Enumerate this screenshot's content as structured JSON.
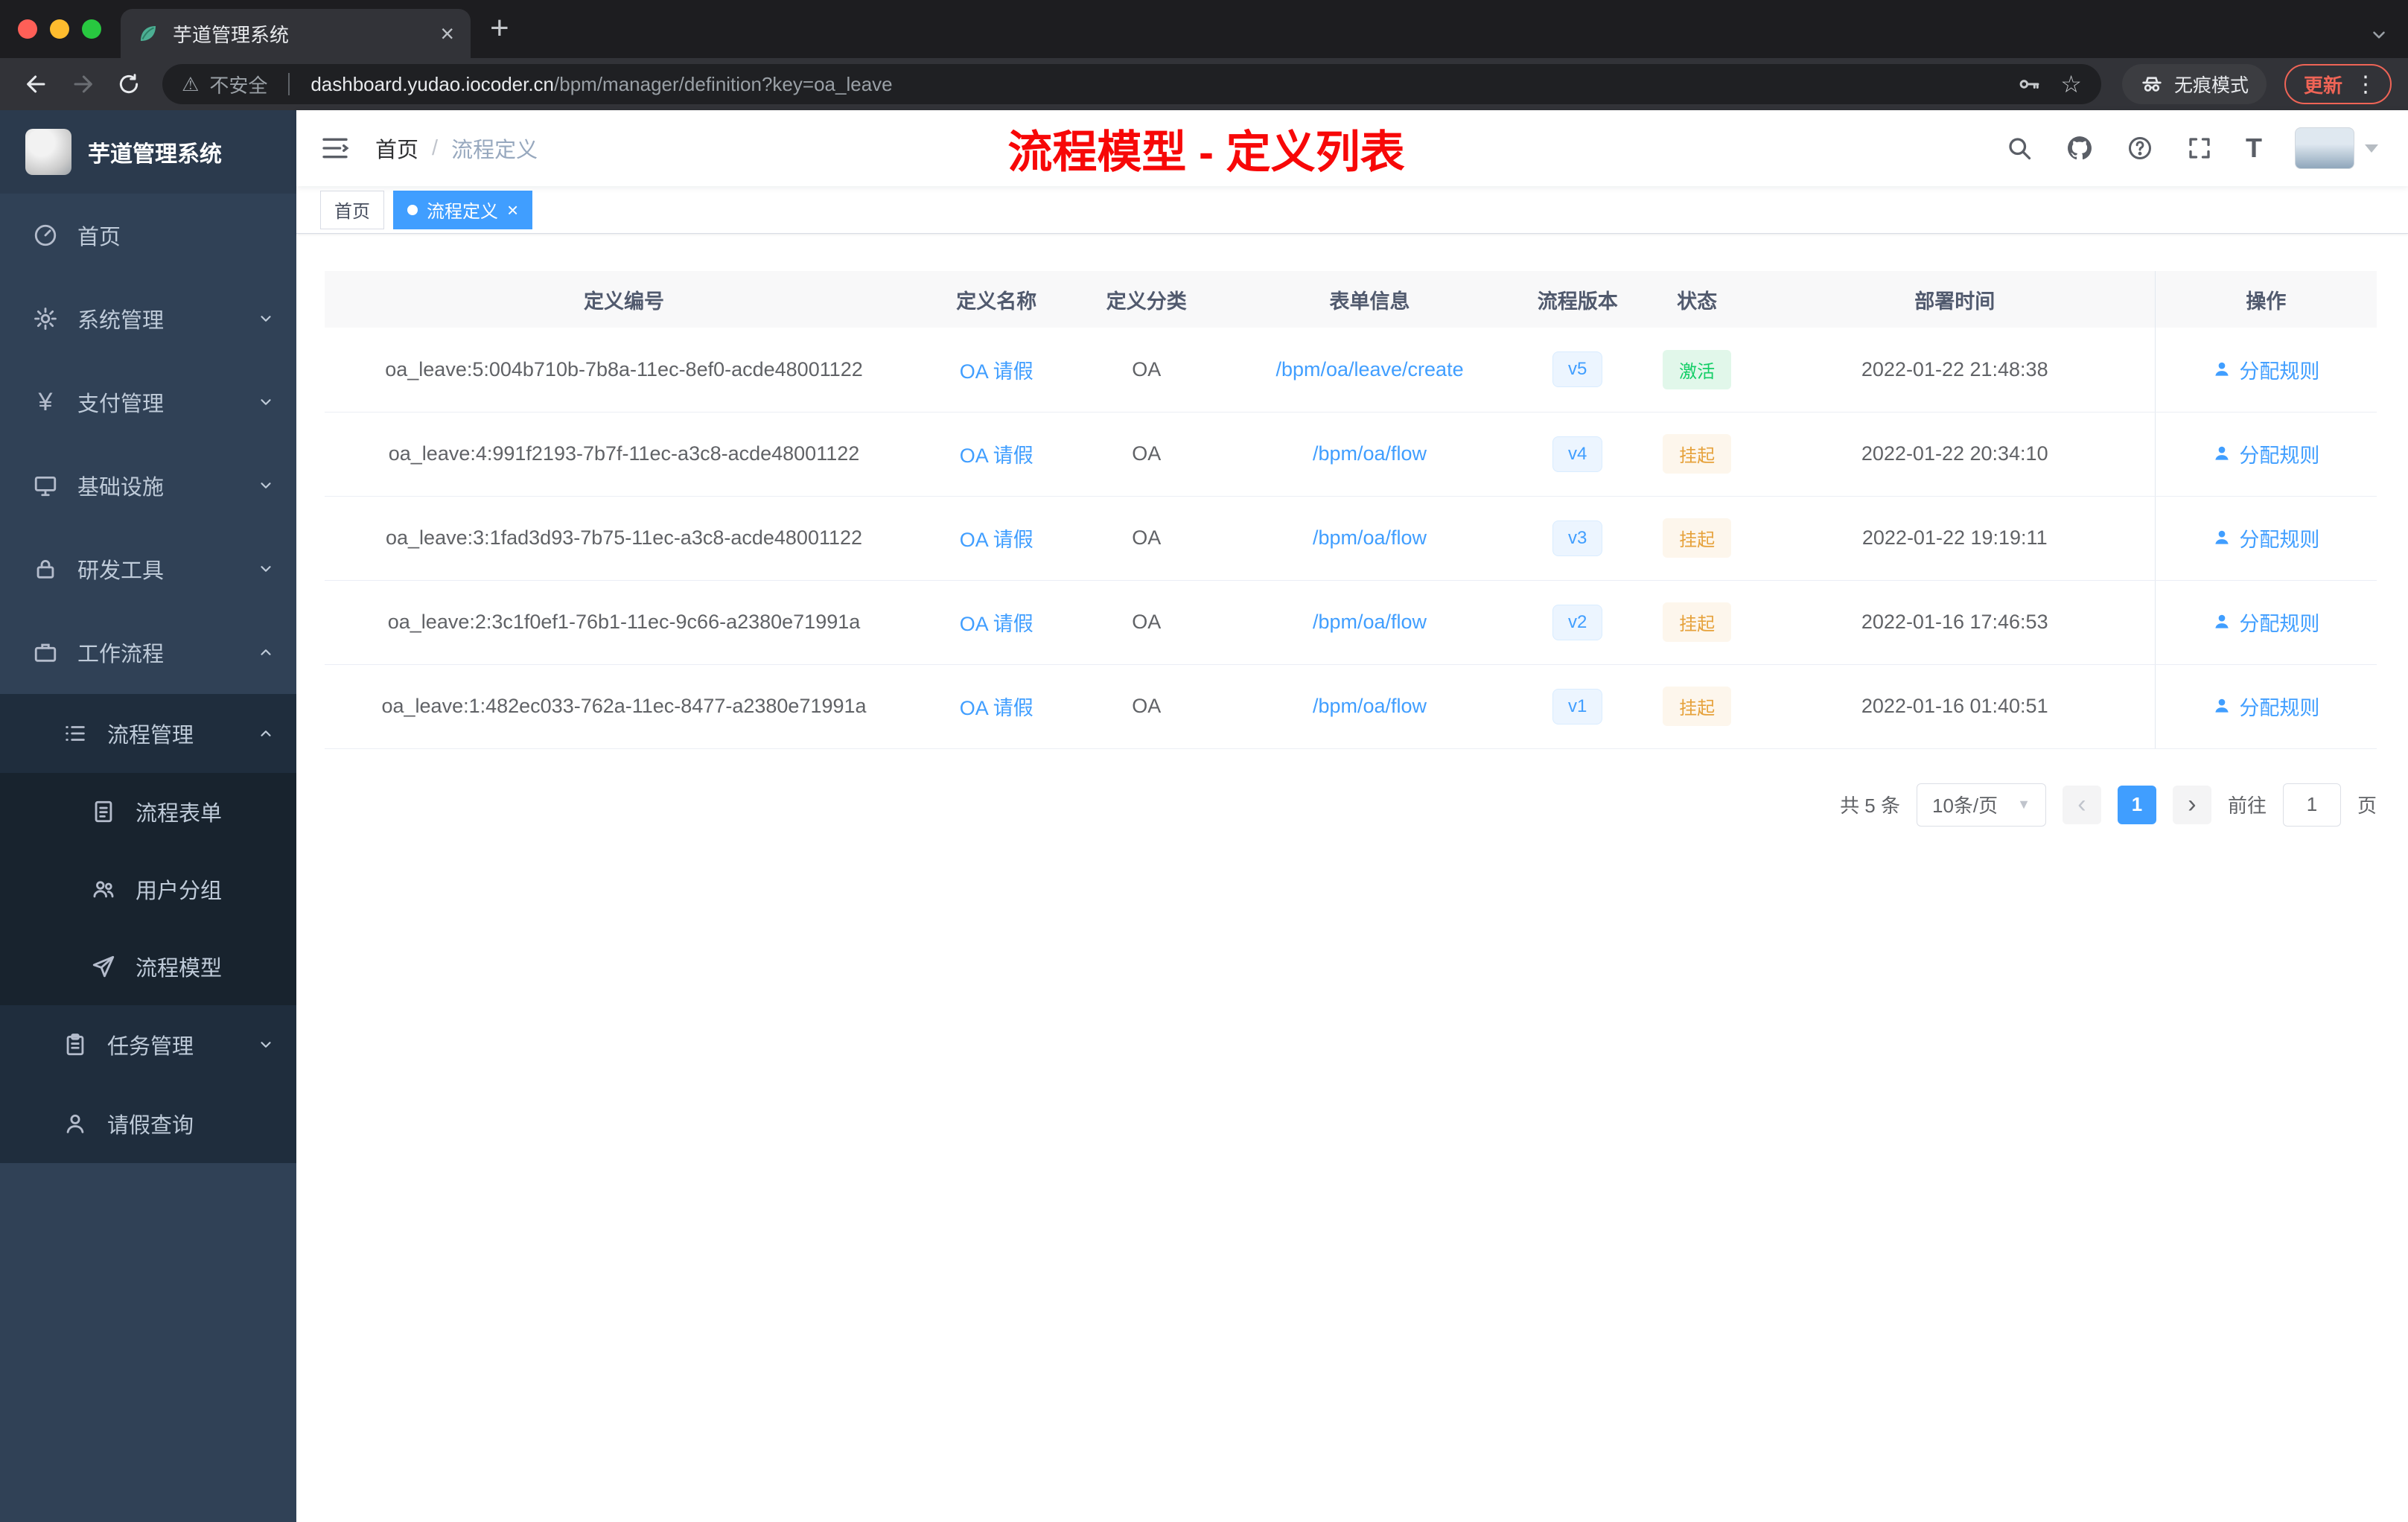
{
  "browser": {
    "tab_title": "芋道管理系统",
    "security_label": "不安全",
    "url_host": "dashboard.yudao.iocoder.cn",
    "url_path": "/bpm/manager/definition?key=oa_leave",
    "incognito_label": "无痕模式",
    "update_label": "更新"
  },
  "sidebar": {
    "title": "芋道管理系统",
    "items": [
      {
        "label": "首页"
      },
      {
        "label": "系统管理"
      },
      {
        "label": "支付管理"
      },
      {
        "label": "基础设施"
      },
      {
        "label": "研发工具"
      },
      {
        "label": "工作流程"
      },
      {
        "label": "流程管理"
      },
      {
        "label": "流程表单"
      },
      {
        "label": "用户分组"
      },
      {
        "label": "流程模型"
      },
      {
        "label": "任务管理"
      },
      {
        "label": "请假查询"
      }
    ]
  },
  "navbar": {
    "breadcrumb_home": "首页",
    "breadcrumb_sep": "/",
    "breadcrumb_current": "流程定义",
    "annotation": "流程模型 - 定义列表"
  },
  "tags": {
    "home": "首页",
    "active": "流程定义"
  },
  "table": {
    "columns": [
      "定义编号",
      "定义名称",
      "定义分类",
      "表单信息",
      "流程版本",
      "状态",
      "部署时间",
      "操作"
    ],
    "rows": [
      {
        "id": "oa_leave:5:004b710b-7b8a-11ec-8ef0-acde48001122",
        "name": "OA 请假",
        "category": "OA",
        "form": "/bpm/oa/leave/create",
        "version": "v5",
        "status": "激活",
        "deploy_time": "2022-01-22 21:48:38",
        "action": "分配规则"
      },
      {
        "id": "oa_leave:4:991f2193-7b7f-11ec-a3c8-acde48001122",
        "name": "OA 请假",
        "category": "OA",
        "form": "/bpm/oa/flow",
        "version": "v4",
        "status": "挂起",
        "deploy_time": "2022-01-22 20:34:10",
        "action": "分配规则"
      },
      {
        "id": "oa_leave:3:1fad3d93-7b75-11ec-a3c8-acde48001122",
        "name": "OA 请假",
        "category": "OA",
        "form": "/bpm/oa/flow",
        "version": "v3",
        "status": "挂起",
        "deploy_time": "2022-01-22 19:19:11",
        "action": "分配规则"
      },
      {
        "id": "oa_leave:2:3c1f0ef1-76b1-11ec-9c66-a2380e71991a",
        "name": "OA 请假",
        "category": "OA",
        "form": "/bpm/oa/flow",
        "version": "v2",
        "status": "挂起",
        "deploy_time": "2022-01-16 17:46:53",
        "action": "分配规则"
      },
      {
        "id": "oa_leave:1:482ec033-762a-11ec-8477-a2380e71991a",
        "name": "OA 请假",
        "category": "OA",
        "form": "/bpm/oa/flow",
        "version": "v1",
        "status": "挂起",
        "deploy_time": "2022-01-16 01:40:51",
        "action": "分配规则"
      }
    ]
  },
  "pagination": {
    "total": "共 5 条",
    "page_size": "10条/页",
    "page": "1",
    "goto_label": "前往",
    "goto_value": "1",
    "unit": "页"
  }
}
